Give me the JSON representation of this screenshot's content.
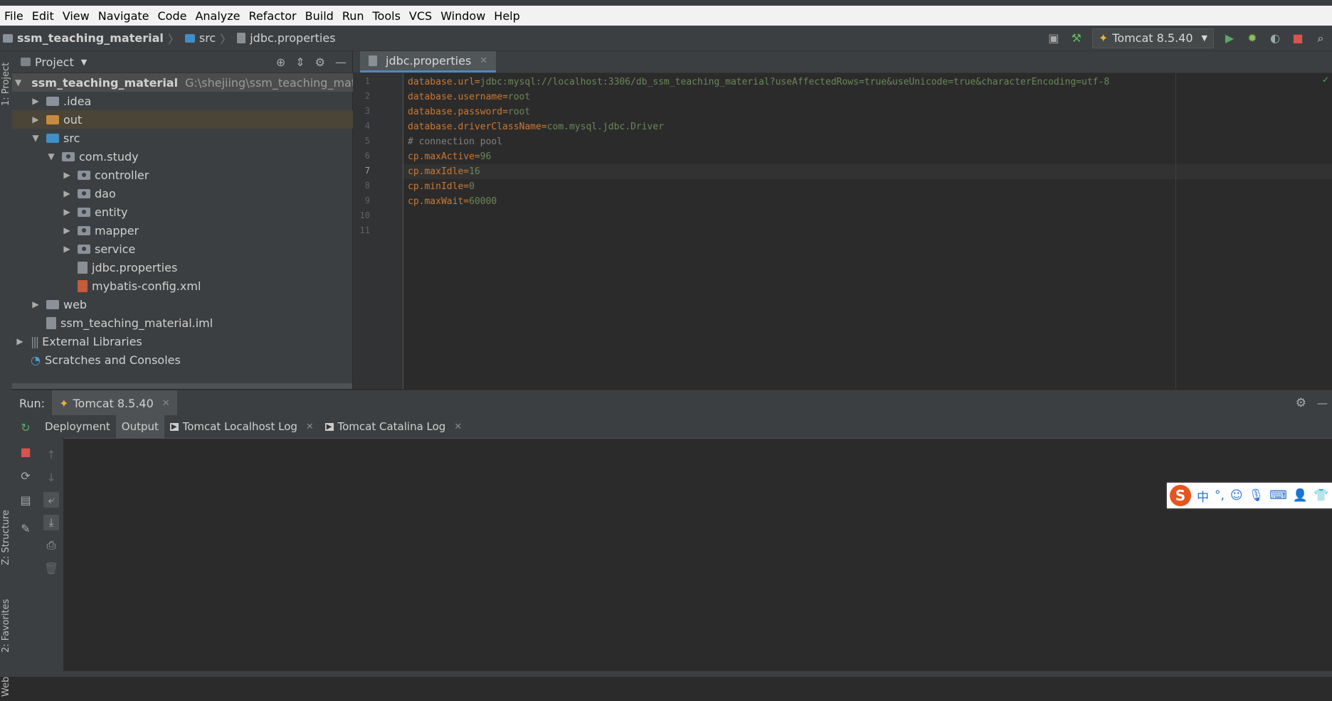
{
  "menu": [
    "File",
    "Edit",
    "View",
    "Navigate",
    "Code",
    "Analyze",
    "Refactor",
    "Build",
    "Run",
    "Tools",
    "VCS",
    "Window",
    "Help"
  ],
  "breadcrumb": [
    "ssm_teaching_material",
    "src",
    "jdbc.properties"
  ],
  "run_config": {
    "label": "Tomcat 8.5.40"
  },
  "left_strip": {
    "project_tab": "1: Project",
    "structure_tab": "Z: Structure",
    "favorites_tab": "2: Favorites",
    "web_tab": "Web"
  },
  "project": {
    "header": "Project",
    "tree": [
      {
        "label": "ssm_teaching_material",
        "note": "G:\\shejiing\\ssm_teaching_material"
      },
      {
        "label": ".idea"
      },
      {
        "label": "out"
      },
      {
        "label": "src"
      },
      {
        "label": "com.study"
      },
      {
        "label": "controller"
      },
      {
        "label": "dao"
      },
      {
        "label": "entity"
      },
      {
        "label": "mapper"
      },
      {
        "label": "service"
      },
      {
        "label": "jdbc.properties"
      },
      {
        "label": "mybatis-config.xml"
      },
      {
        "label": "web"
      },
      {
        "label": "ssm_teaching_material.iml"
      },
      {
        "label": "External Libraries"
      },
      {
        "label": "Scratches and Consoles"
      }
    ]
  },
  "editor": {
    "tab": "jdbc.properties",
    "line_numbers": [
      "1",
      "2",
      "3",
      "4",
      "5",
      "6",
      "7",
      "8",
      "9",
      "10",
      "11"
    ],
    "lines": [
      {
        "key": "database.url",
        "eq": "=",
        "val": "jdbc:mysql://localhost:3306/db_ssm_teaching_material?useAffectedRows=true&useUnicode=true&characterEncoding=utf-8"
      },
      {
        "key": "database.username",
        "eq": "=",
        "val": "root"
      },
      {
        "key": "database.password",
        "eq": "=",
        "val": "root"
      },
      {
        "key": "database.driverClassName",
        "eq": "=",
        "val": "com.mysql.jdbc.Driver"
      },
      {
        "comment": "# connection pool"
      },
      {
        "key": "cp.maxActive",
        "eq": "=",
        "val": "96"
      },
      {
        "key": "cp.maxIdle",
        "eq": "=",
        "val": "16"
      },
      {
        "key": "cp.minIdle",
        "eq": "=",
        "val": "0"
      },
      {
        "key": "cp.maxWait",
        "eq": "=",
        "val": "60000"
      }
    ]
  },
  "run": {
    "label": "Run:",
    "tab": "Tomcat 8.5.40",
    "subtabs": [
      "Deployment",
      "Output",
      "Tomcat Localhost Log",
      "Tomcat Catalina Log"
    ]
  },
  "ime": {
    "logo": "S",
    "lang": "中",
    "punct": "°,"
  }
}
